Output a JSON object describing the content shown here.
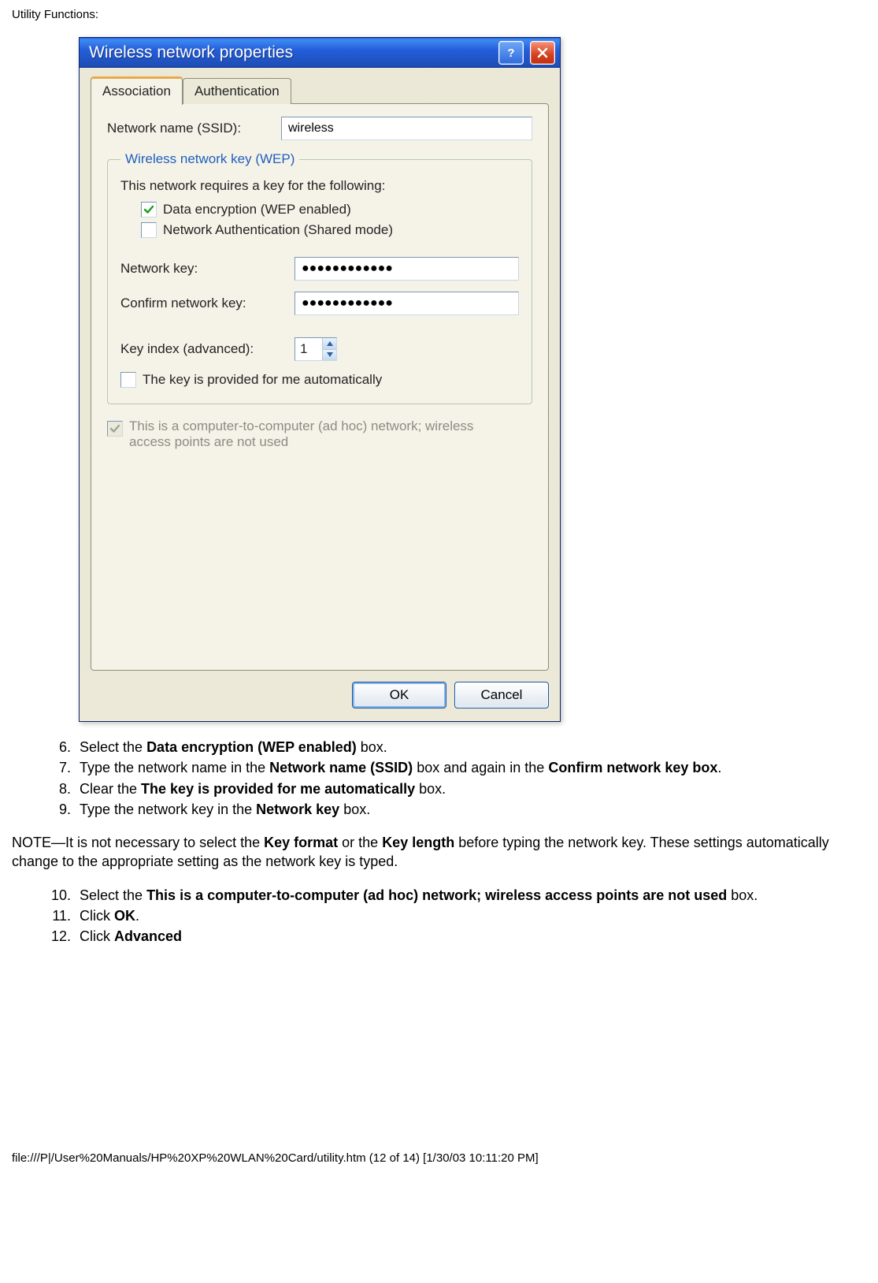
{
  "page": {
    "header": "Utility Functions:",
    "footer_path": "file:///P|/User%20Manuals/HP%20XP%20WLAN%20Card/utility.htm (12 of 14) [1/30/03 10:11:20 PM]"
  },
  "dialog": {
    "title": "Wireless network properties",
    "tabs": {
      "association": "Association",
      "authentication": "Authentication"
    },
    "ssid_label": "Network name (SSID):",
    "ssid_value": "wireless",
    "group_legend": "Wireless network key (WEP)",
    "group_intro": "This network requires a key for the following:",
    "ck_data_enc": "Data encryption (WEP enabled)",
    "ck_net_auth": "Network Authentication (Shared mode)",
    "netkey_label": "Network key:",
    "netkey_value": "●●●●●●●●●●●●",
    "confirm_label": "Confirm network key:",
    "confirm_value": "●●●●●●●●●●●●",
    "keyindex_label": "Key index (advanced):",
    "keyindex_value": "1",
    "ck_autokey": "The key is provided for me automatically",
    "ck_adhoc": "This is a computer-to-computer (ad hoc) network; wireless access points are not used",
    "ok": "OK",
    "cancel": "Cancel"
  },
  "steps_a": {
    "s6_pre": "Select the ",
    "s6_b": "Data encryption (WEP enabled)",
    "s6_post": " box.",
    "s7_pre": "Type the network name in the ",
    "s7_b1": "Network name (SSID)",
    "s7_mid": " box and again in the ",
    "s7_b2": "Confirm network key box",
    "s7_post": ".",
    "s8_pre": "Clear the ",
    "s8_b": "The key is provided for me automatically",
    "s8_post": " box.",
    "s9_pre": "Type the network key in the ",
    "s9_b": "Network key",
    "s9_post": " box."
  },
  "note": {
    "pre": "NOTE—It is not necessary to select the ",
    "b1": "Key format",
    "mid1": " or the ",
    "b2": "Key length",
    "post": " before typing the network key. These settings automatically change to the appropriate setting as the network key is typed."
  },
  "steps_b": {
    "s10_pre": "Select the ",
    "s10_b": "This is a computer-to-computer (ad hoc) network; wireless access points are not used",
    "s10_post": " box.",
    "s11_pre": "Click ",
    "s11_b": "OK",
    "s11_post": ".",
    "s12_pre": "Click ",
    "s12_b": "Advanced"
  }
}
